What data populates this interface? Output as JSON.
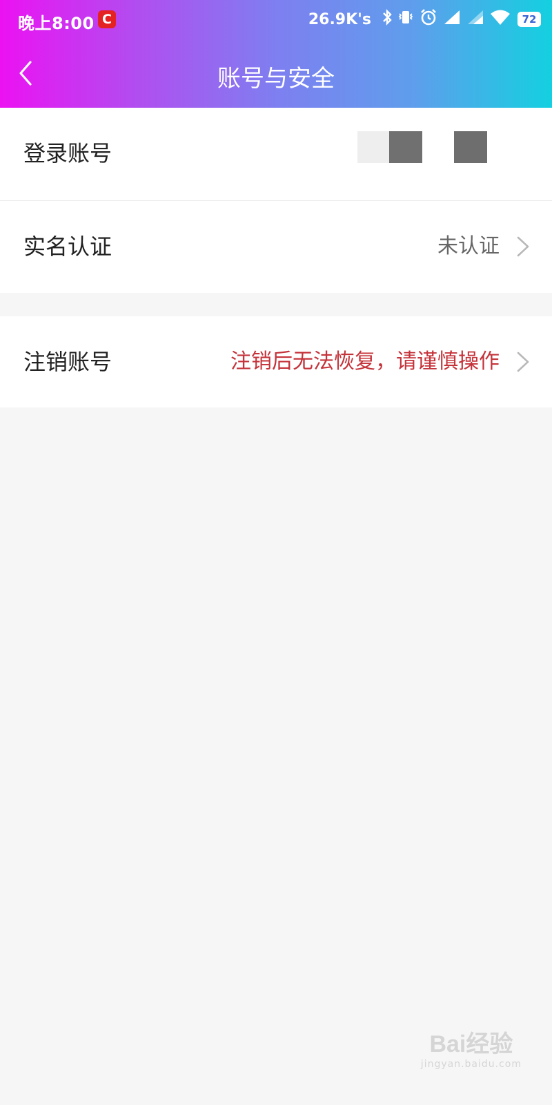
{
  "status_bar": {
    "time": "晚上8:00",
    "app_icon_letter": "C",
    "net_speed": "26.9K's",
    "battery": "72"
  },
  "nav": {
    "title": "账号与安全"
  },
  "rows": {
    "login_account": {
      "label": "登录账号"
    },
    "real_name": {
      "label": "实名认证",
      "value": "未认证"
    },
    "cancel_account": {
      "label": "注销账号",
      "value": "注销后无法恢复，请谨慎操作"
    }
  },
  "watermark": {
    "logo": "Bai经验",
    "url": "jingyan.baidu.com"
  },
  "colors": {
    "header_gradient_start": "#ec11f2",
    "header_gradient_end": "#14d0e0",
    "warning_text": "#c4333a",
    "page_background": "#f6f6f6"
  }
}
